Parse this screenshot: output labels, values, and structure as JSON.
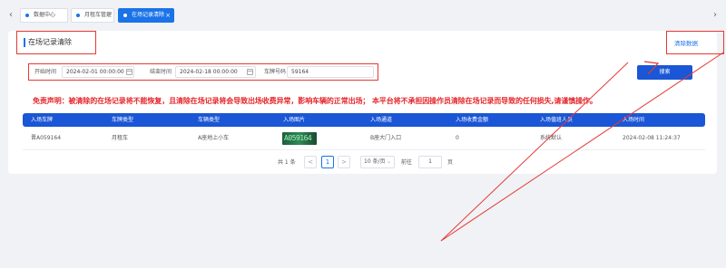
{
  "tabs": [
    {
      "label": "数据中心"
    },
    {
      "label": "月租车管理"
    },
    {
      "label": "在场记录清除"
    }
  ],
  "page": {
    "title": "在场记录清除",
    "clear_link": "清除数据"
  },
  "filters": {
    "start_label": "开始时间",
    "start_value": "2024-02-01 00:00:00",
    "end_label": "结束时间",
    "end_value": "2024-02-18 00:00:00",
    "plate_label": "车牌号码",
    "plate_value": "59164"
  },
  "search_button": "搜索",
  "disclaimer": "免责声明：被清除的在场记录将不能恢复，且清除在场记录将会导致出场收费异常，影响车辆的正常出场； 本平台将不承担因操作员清除在场记录而导致的任何损失,请谨慎操作。",
  "table": {
    "headers": [
      "入场车牌",
      "车牌类型",
      "车辆类型",
      "入场图片",
      "入场通道",
      "入场收费金额",
      "入场值班人员",
      "入场时间"
    ],
    "rows": [
      [
        "晋A059164",
        "月租车",
        "A座地上小车",
        "",
        "B座大门入口",
        "0",
        "系统默认",
        "2024-02-08 11:24:37"
      ]
    ],
    "image_plate_text": "A059164"
  },
  "pagination": {
    "total": "共 1 条",
    "prev": "<",
    "page": "1",
    "next": ">",
    "page_size": "10 条/页",
    "goto_label": "前往",
    "goto_value": "1",
    "page_suffix": "页"
  },
  "colors": {
    "accent": "#1a56d6",
    "warning": "#e5262a",
    "annotation": "#e53935"
  }
}
